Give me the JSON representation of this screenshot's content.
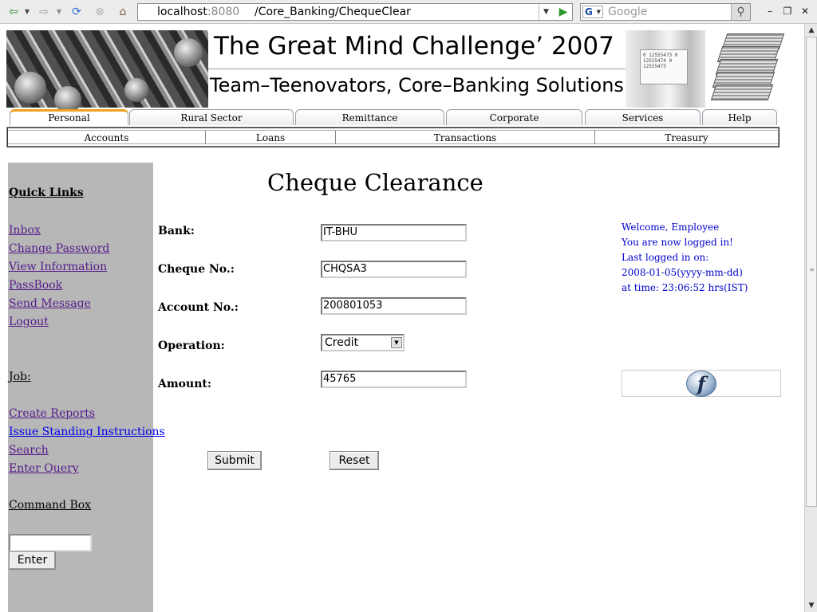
{
  "browser": {
    "url_host": "localhost",
    "url_port": ":8080",
    "url_path": "/Core_Banking/ChequeClear",
    "search_placeholder": "Google"
  },
  "banner": {
    "title": "The Great Mind Challenge’ 2007",
    "subtitle": "Team–Teenovators, Core–Banking Solutions",
    "bill_text": "0 12555473 0 12555474 0 12555475"
  },
  "nav_tabs": [
    "Personal",
    "Rural Sector",
    "Remittance",
    "Corporate",
    "Services",
    "Help"
  ],
  "active_tab": "Personal",
  "sub_menu": [
    "Accounts",
    "Loans",
    "Transactions",
    "Treasury"
  ],
  "sidebar": {
    "quick_links_title": "Quick Links",
    "quick_links": [
      "Inbox",
      "Change Password",
      "View Information",
      "PassBook",
      "Send Message",
      "Logout"
    ],
    "job_title": "Job:",
    "job_links": [
      "Create Reports",
      "Issue Standing Instructions",
      "Search",
      "Enter Query"
    ],
    "command_title": "Command Box",
    "command_value": "",
    "enter_label": "Enter"
  },
  "form": {
    "title": "Cheque Clearance",
    "bank_label": "Bank:",
    "bank_value": "IT-BHU",
    "cheque_label": "Cheque No.:",
    "cheque_value": "CHQSA3",
    "account_label": "Account No.:",
    "account_value": "200801053",
    "operation_label": "Operation:",
    "operation_value": "Credit",
    "amount_label": "Amount:",
    "amount_value": "45765",
    "submit_label": "Submit",
    "reset_label": "Reset"
  },
  "welcome": {
    "line1": "Welcome, Employee",
    "line2": "You are now logged in!",
    "line3": "Last logged in on:",
    "line4": "2008-01-05(yyyy-mm-dd)",
    "line5": "at time: 23:06:52 hrs(IST)"
  },
  "colors": {
    "sidebar_bg": "#b7b7b7",
    "link_visited": "#551a8b",
    "link_unvisited": "#0000ee",
    "welcome_text": "#0000cc",
    "active_tab_accent": "#f0a020"
  }
}
